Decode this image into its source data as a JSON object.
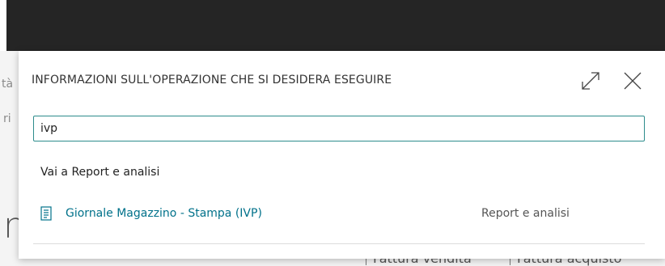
{
  "background": {
    "side_text_1": "tà",
    "side_text_2": "ri",
    "big_text": "n",
    "bottom_link_1": "Fattura vendita",
    "bottom_link_2": "Fattura acquisto"
  },
  "dialog": {
    "title": "INFORMAZIONI SULL'OPERAZIONE CHE SI DESIDERA ESEGUIRE",
    "expand_icon": "expand-icon",
    "close_icon": "close-icon",
    "search_value": "ivp",
    "section_heading": "Vai a Report e analisi",
    "results": [
      {
        "icon": "report-icon",
        "label": "Giornale Magazzino - Stampa (IVP)",
        "category": "Report e analisi"
      }
    ]
  },
  "colors": {
    "accent": "#00718a",
    "input_border": "#2d8c8c",
    "top_bar": "#252525"
  }
}
